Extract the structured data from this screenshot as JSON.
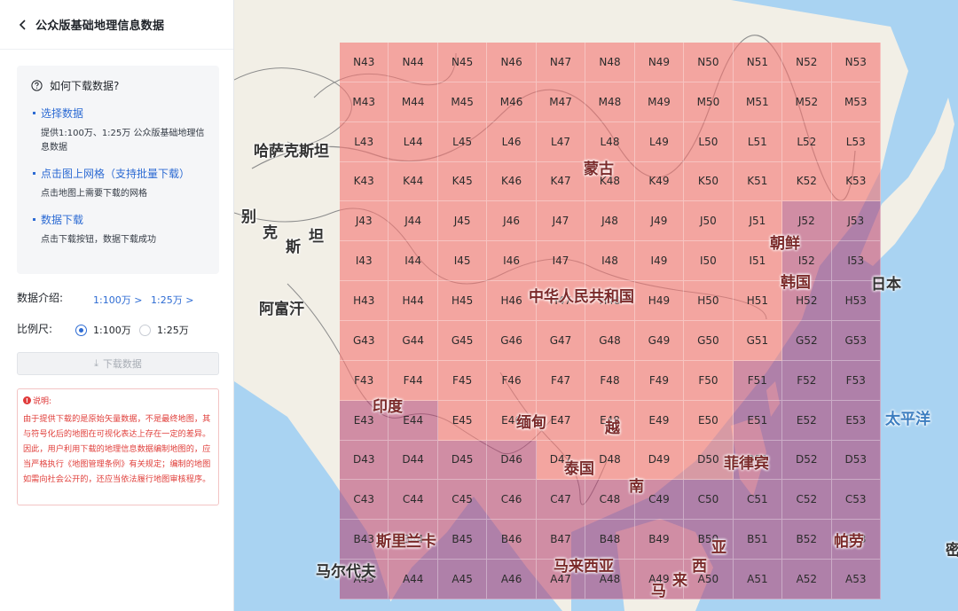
{
  "header": {
    "title": "公众版基础地理信息数据"
  },
  "help": {
    "title": "如何下载数据?",
    "steps": [
      {
        "title": "选择数据",
        "desc": "提供1:100万、1:25万 公众版基础地理信息数据"
      },
      {
        "title": "点击图上网格（支持批量下载）",
        "desc": "点击地图上需要下载的网格"
      },
      {
        "title": "数据下载",
        "desc": "点击下载按钮，数据下载成功"
      }
    ]
  },
  "intro": {
    "label": "数据介绍:",
    "links": [
      "1:100万 >",
      "1:25万 >"
    ]
  },
  "scale": {
    "label": "比例尺:",
    "options": [
      "1:100万",
      "1:25万"
    ],
    "selected": "1:100万"
  },
  "download_button": "下载数据",
  "note": {
    "title": "说明:",
    "text": "由于提供下载的是原始矢量数据，不是最终地图，其与符号化后的地图在可视化表达上存在一定的差异。因此，用户利用下载的地理信息数据编制地图的，应当严格执行《地图管理条例》有关规定；编制的地图如需向社会公开的，还应当依法履行地图审核程序。"
  },
  "map": {
    "grid_rows": [
      "N",
      "M",
      "L",
      "K",
      "J",
      "I",
      "H",
      "G",
      "F",
      "E",
      "D",
      "C",
      "B",
      "A"
    ],
    "row_letters": [
      "N",
      "M",
      "L",
      "K",
      "J",
      "I",
      "H",
      "G",
      "F",
      "E",
      "D",
      "C",
      "B",
      "A"
    ],
    "cols": [
      "43",
      "44",
      "45",
      "46",
      "47",
      "48",
      "49",
      "50",
      "51",
      "52",
      "53"
    ],
    "labels": [
      "哈萨克斯坦",
      "别",
      "克",
      "斯",
      "坦",
      "阿富汗",
      "蒙古",
      "朝鲜",
      "韩国",
      "日本",
      "中华人民共和国",
      "印度",
      "缅甸",
      "越",
      "泰国",
      "南",
      "菲律宾",
      "太平洋",
      "斯里兰卡",
      "马来西亚",
      "马尔代夫",
      "帕劳",
      "亚",
      "西",
      "来",
      "马",
      "密"
    ],
    "colors": {
      "land_overlay": "#f47874",
      "sea_overlay": "#b43c6e",
      "accent": "#2d6bd3"
    }
  }
}
